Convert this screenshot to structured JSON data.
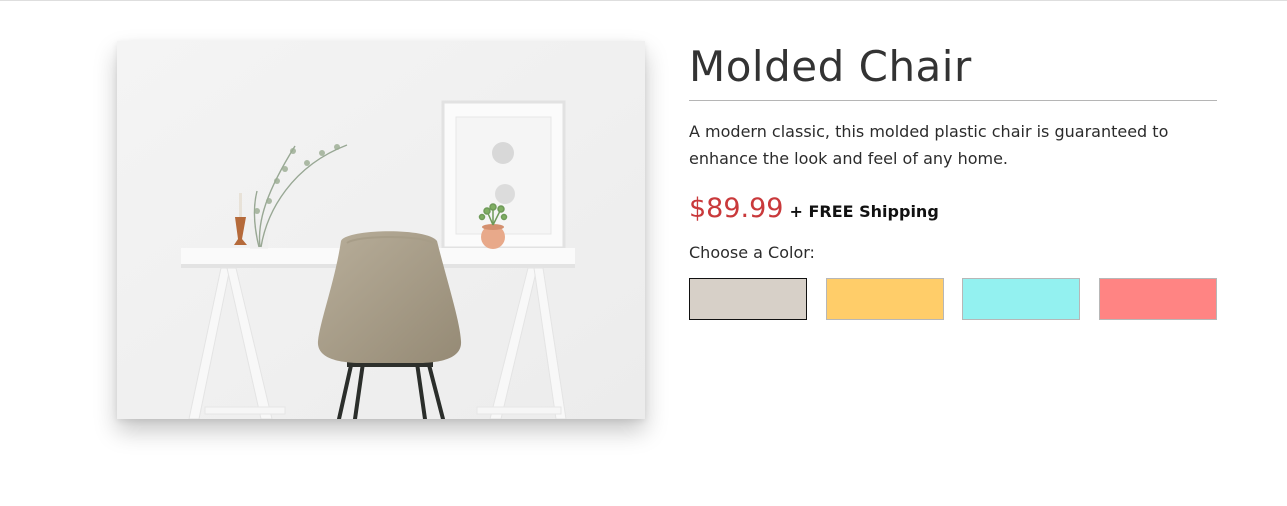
{
  "product": {
    "image_alt": "White desk with a molded chair, plant vase and framed art",
    "title": "Molded Chair",
    "description": "A modern classic, this molded plastic chair is guaranteed to enhance the look and feel of any home.",
    "price": "$89.99",
    "shipping": "+ FREE Shipping",
    "color_label": "Choose a Color:",
    "colors": [
      {
        "name": "taupe",
        "hex": "#d7d0c8",
        "selected": true
      },
      {
        "name": "yellow",
        "hex": "#ffcd69",
        "selected": false
      },
      {
        "name": "aqua",
        "hex": "#93f1f0",
        "selected": false
      },
      {
        "name": "coral",
        "hex": "#ff8483",
        "selected": false
      }
    ]
  },
  "colors": {
    "price": "#c9393b",
    "title": "#333333"
  }
}
